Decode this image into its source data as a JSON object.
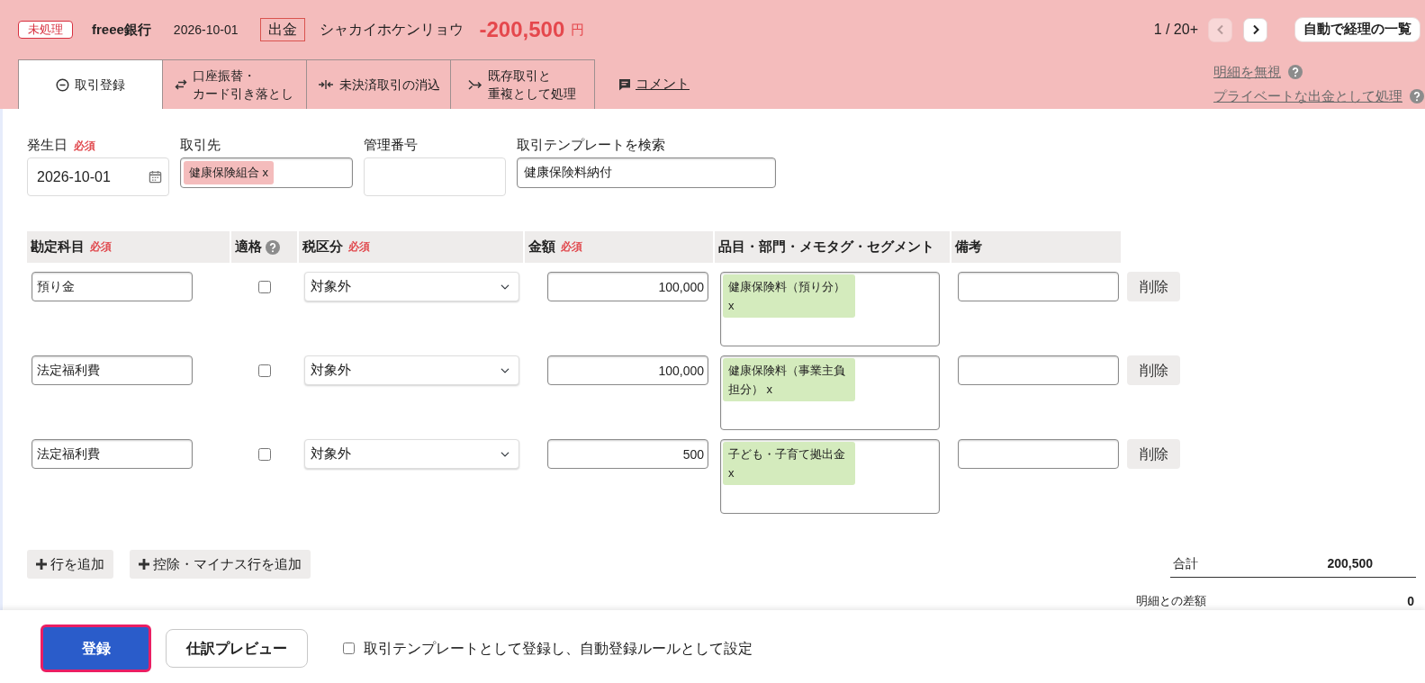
{
  "header": {
    "status": "未処理",
    "account": "freee銀行",
    "date": "2026-10-01",
    "direction": "出金",
    "description": "シャカイホケンリョウ",
    "amount": "-200,500",
    "currency": "円",
    "pager": {
      "position": "1 / 20+",
      "prev_disabled": true,
      "next_disabled": false
    },
    "list_button": "自動で経理の一覧"
  },
  "tabs": [
    {
      "kind": "register",
      "label": "取引登録",
      "selected": true
    },
    {
      "kind": "transfer",
      "label": "口座振替・カード引き落とし",
      "selected": false
    },
    {
      "kind": "settle",
      "label": "未決済取引の消込",
      "selected": false
    },
    {
      "kind": "duplicate",
      "label": "既存取引と重複として処理",
      "selected": false
    }
  ],
  "comment_link": "コメント",
  "side_links": [
    {
      "label": "明細を無視"
    },
    {
      "label": "プライベートな出金として処理"
    }
  ],
  "form": {
    "fields": [
      {
        "kind": "date",
        "label": "発生日",
        "required": "必須",
        "value": "2026-10-01"
      },
      {
        "kind": "tags",
        "label": "取引先",
        "tags": [
          "健康保険組合 x"
        ]
      },
      {
        "kind": "text",
        "label": "管理番号"
      },
      {
        "kind": "search",
        "label": "取引テンプレートを検索",
        "value": "健康保険料納付"
      }
    ]
  },
  "lines": {
    "columns": [
      {
        "label": "勘定科目",
        "required": "必須"
      },
      {
        "label": "適格",
        "help": true
      },
      {
        "label": "税区分",
        "required": "必須"
      },
      {
        "label": "金額",
        "required": "必須"
      },
      {
        "label": "品目・部門・メモタグ・セグメント"
      },
      {
        "label": "備考"
      }
    ],
    "rows": [
      {
        "account": "預り金",
        "qualified": false,
        "tax": "対象外",
        "amount": "100,000",
        "tags": [
          "健康保険料（預り分） x"
        ],
        "delete": "削除"
      },
      {
        "account": "法定福利費",
        "qualified": false,
        "tax": "対象外",
        "amount": "100,000",
        "tags": [
          "健康保険料（事業主負担分） x"
        ],
        "delete": "削除"
      },
      {
        "account": "法定福利費",
        "qualified": false,
        "tax": "対象外",
        "amount": "500",
        "tags": [
          "子ども・子育て拠出金 x"
        ],
        "delete": "削除"
      }
    ]
  },
  "add_buttons": [
    "行を追加",
    "控除・マイナス行を追加"
  ],
  "totals": {
    "total_label": "合計",
    "total": "200,500",
    "diff_label": "明細との差額",
    "diff": "0"
  },
  "footer": {
    "submit": {
      "label": "登録",
      "focused": true
    },
    "preview": "仕訳プレビュー",
    "template_option": {
      "label": "取引テンプレートとして登録し、自動登録ルールとして設定",
      "checked": false
    }
  }
}
